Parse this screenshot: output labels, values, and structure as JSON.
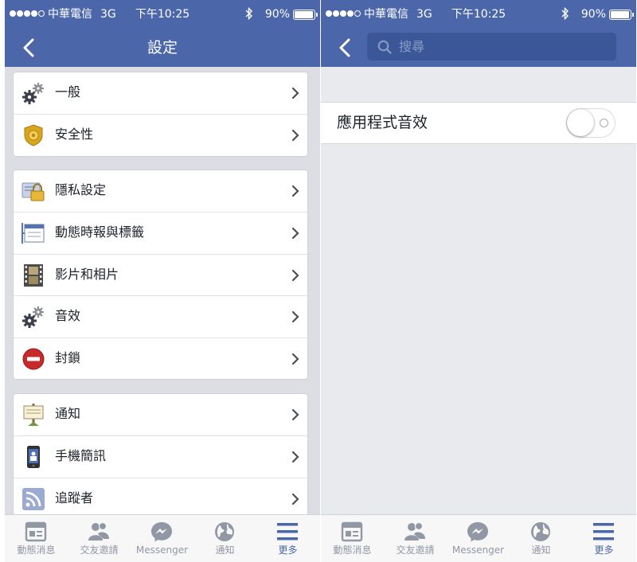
{
  "status_bar": {
    "carrier": "中華電信",
    "network": "3G",
    "time": "下午10:25",
    "battery": "90%",
    "battery_level": 0.9
  },
  "left_screen": {
    "title": "設定",
    "groups": [
      {
        "items": [
          {
            "label": "一般",
            "icon": "gear-icon"
          },
          {
            "label": "安全性",
            "icon": "security-badge-icon"
          }
        ]
      },
      {
        "items": [
          {
            "label": "隱私設定",
            "icon": "privacy-lock-icon"
          },
          {
            "label": "動態時報與標籤",
            "icon": "timeline-icon"
          },
          {
            "label": "影片和相片",
            "icon": "film-strip-icon"
          },
          {
            "label": "音效",
            "icon": "gear-icon"
          },
          {
            "label": "封鎖",
            "icon": "block-icon"
          }
        ]
      },
      {
        "items": [
          {
            "label": "通知",
            "icon": "notification-sign-icon"
          },
          {
            "label": "手機簡訊",
            "icon": "mobile-phone-icon"
          },
          {
            "label": "追蹤者",
            "icon": "rss-icon"
          }
        ]
      }
    ]
  },
  "right_screen": {
    "search_placeholder": "搜尋",
    "sound_setting": {
      "label": "應用程式音效",
      "enabled": false
    }
  },
  "tab_bar": {
    "tabs": [
      {
        "label": "動態消息",
        "icon": "news-feed-icon"
      },
      {
        "label": "交友邀請",
        "icon": "friends-icon"
      },
      {
        "label": "Messenger",
        "icon": "messenger-icon"
      },
      {
        "label": "通知",
        "icon": "globe-icon"
      },
      {
        "label": "更多",
        "icon": "menu-icon",
        "active": true
      }
    ]
  },
  "colors": {
    "brand_blue": "#4b67a9",
    "search_field": "#3b5797",
    "tab_active": "#4b67a9",
    "tab_inactive": "#9197a3"
  }
}
